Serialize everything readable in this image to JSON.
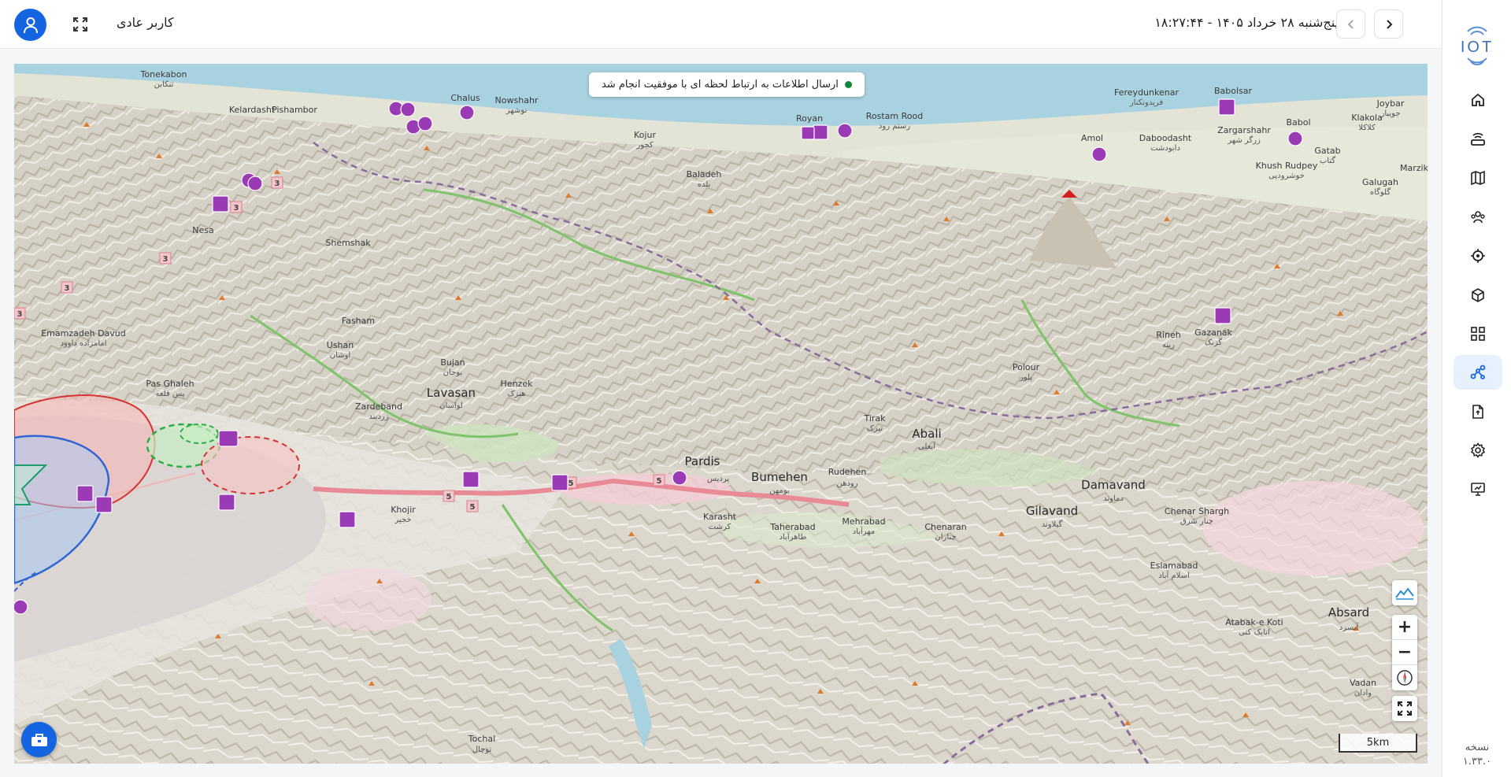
{
  "header": {
    "username": "کاربر عادی",
    "datetime": "پنج‌شنبه ۲۸ خرداد ۱۴۰۵ - ۱۸:۲۷:۴۴"
  },
  "sidebar": {
    "logo_text": "IOT",
    "items": [
      {
        "name": "home",
        "icon": "home-icon"
      },
      {
        "name": "devices",
        "icon": "router-icon"
      },
      {
        "name": "map",
        "icon": "map-icon"
      },
      {
        "name": "users",
        "icon": "users-icon"
      },
      {
        "name": "tracking",
        "icon": "target-icon"
      },
      {
        "name": "products",
        "icon": "cube-icon"
      },
      {
        "name": "dashboard",
        "icon": "grid-icon"
      },
      {
        "name": "network",
        "icon": "network-icon",
        "active": true
      },
      {
        "name": "reports",
        "icon": "document-icon"
      },
      {
        "name": "settings",
        "icon": "gear-icon"
      },
      {
        "name": "monitor",
        "icon": "monitor-icon"
      }
    ],
    "version_label": "نسخه",
    "version_number": "۱.۳۳.۰"
  },
  "map": {
    "toast": "ارسال اطلاعات به ارتباط لحظه ای با موفقیت انجام شد",
    "zoom_in": "+",
    "zoom_out": "−",
    "scale": "5km",
    "labels": [
      {
        "en": "Tonekabon",
        "fa": "تنکابن"
      },
      {
        "en": "Nowshahr",
        "fa": "نوشهر"
      },
      {
        "en": "Kelardasht",
        "fa": ""
      },
      {
        "en": "Pishambor",
        "fa": ""
      },
      {
        "en": "Chalus",
        "fa": ""
      },
      {
        "en": "Kojur",
        "fa": "کجور"
      },
      {
        "en": "Royan",
        "fa": ""
      },
      {
        "en": "Rostam Rood",
        "fa": "رستم رود"
      },
      {
        "en": "Fereydunkenar",
        "fa": "فریدونکنار"
      },
      {
        "en": "Babolsar",
        "fa": ""
      },
      {
        "en": "Zargarshahr",
        "fa": "زرگر شهر"
      },
      {
        "en": "Joybar",
        "fa": "جویبار"
      },
      {
        "en": "Babol",
        "fa": ""
      },
      {
        "en": "Klakola",
        "fa": "کلاکلا"
      },
      {
        "en": "Amol",
        "fa": ""
      },
      {
        "en": "Daboodasht",
        "fa": "دابودشت"
      },
      {
        "en": "Gatab",
        "fa": "گتاب"
      },
      {
        "en": "Khush Rudpey",
        "fa": "خوشرودپی"
      },
      {
        "en": "Marzik",
        "fa": ""
      },
      {
        "en": "Galugah",
        "fa": "گلوگاه"
      },
      {
        "en": "Baladeh",
        "fa": "بلده"
      },
      {
        "en": "Nesa",
        "fa": ""
      },
      {
        "en": "Shemshak",
        "fa": ""
      },
      {
        "en": "Fasham",
        "fa": ""
      },
      {
        "en": "Emamzadeh Davud",
        "fa": "امامزاده داوود"
      },
      {
        "en": "Ushan",
        "fa": "اوشان"
      },
      {
        "en": "Pas Ghaleh",
        "fa": "پس قلعه"
      },
      {
        "en": "Bujan",
        "fa": "بوجان"
      },
      {
        "en": "Zardeband",
        "fa": "زردبند"
      },
      {
        "en": "Lavasan",
        "fa": "لواسان"
      },
      {
        "en": "Henzek",
        "fa": "هنزک"
      },
      {
        "en": "Rineh",
        "fa": "رینه"
      },
      {
        "en": "Gazanak",
        "fa": "گزنک"
      },
      {
        "en": "Polour",
        "fa": "پلور"
      },
      {
        "en": "Tirak",
        "fa": "تیرک"
      },
      {
        "en": "Abali",
        "fa": "آبعلی"
      },
      {
        "en": "Pardis",
        "fa": "پردیس"
      },
      {
        "en": "Bumehen",
        "fa": "بومهن"
      },
      {
        "en": "Rudehen",
        "fa": "رودهن"
      },
      {
        "en": "Damavand",
        "fa": "دماوند"
      },
      {
        "en": "Gilavand",
        "fa": "گیلاوند"
      },
      {
        "en": "Chenar Shargh",
        "fa": "چنار شرق"
      },
      {
        "en": "Karasht",
        "fa": "کرشت"
      },
      {
        "en": "Taherabad",
        "fa": "طاهرآباد"
      },
      {
        "en": "Mehrabad",
        "fa": "مهرآباد"
      },
      {
        "en": "Chenaran",
        "fa": "چناران"
      },
      {
        "en": "Eslamabad",
        "fa": "اسلام آباد"
      },
      {
        "en": "Khojir",
        "fa": "خجیر"
      },
      {
        "en": "Atabak-e Koti",
        "fa": "اتابک کتی"
      },
      {
        "en": "Absard",
        "fa": "آبسرد"
      },
      {
        "en": "Vadan",
        "fa": "وادان"
      },
      {
        "en": "Tochal",
        "fa": "توچال"
      }
    ]
  }
}
